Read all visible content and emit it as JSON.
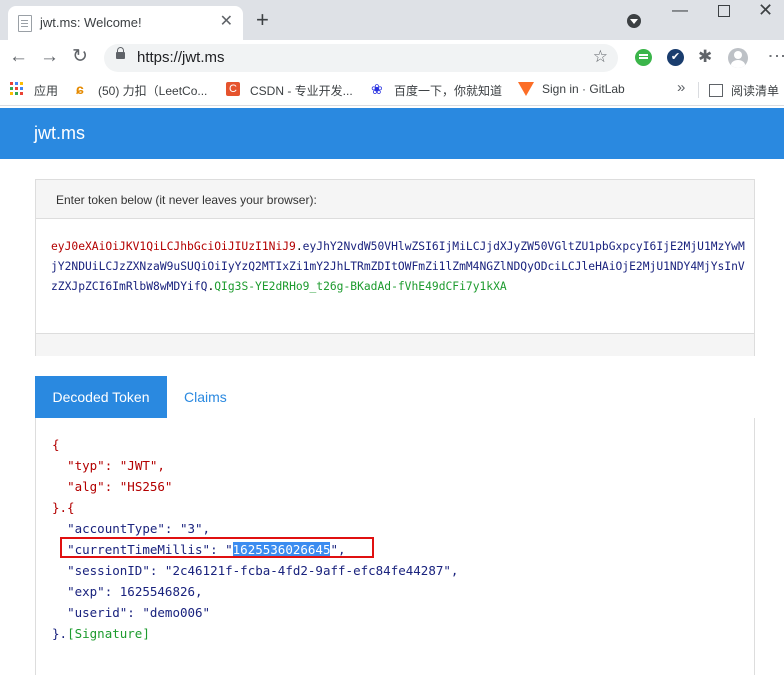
{
  "browser": {
    "tab_title": "jwt.ms: Welcome!",
    "tab_close": "✕",
    "new_tab": "+",
    "url": "https://jwt.ms",
    "win_min": "—",
    "win_close": "✕",
    "back": "←",
    "forward": "→",
    "reload": "↻",
    "star": "☆",
    "more": "⋮",
    "check": "✔",
    "puzzle": "✱",
    "bookmarks": [
      {
        "label": "应用"
      },
      {
        "label": "(50) 力扣（LeetCo..."
      },
      {
        "label": "CSDN - 专业开发..."
      },
      {
        "label": "百度一下，你就知道"
      },
      {
        "label": "Sign in · GitLab"
      }
    ],
    "bookmarks_more": "»",
    "reading_list": "阅读清单"
  },
  "page": {
    "brand": "jwt.ms",
    "input_prompt": "Enter token below (it never leaves your browser):",
    "token": {
      "header": "eyJ0eXAiOiJKV1QiLCJhbGciOiJIUzI1NiJ9",
      "dot1": ".",
      "payload": "eyJhY2NvdW50VHlwZSI6IjMiLCJjdXJyZW50VGltZU1pbGxpcyI6IjE2MjU1MzYwMjY2NDUiLCJzZXNzaW9uSUQiOiIyYzQ2MTIxZi1mY2JhLTRmZDItOWFmZi1lZmM4NGZlNDQyODciLCJleHAiOjE2MjU1NDY4MjYsInVzZXJpZCI6ImRlbW8wMDYifQ",
      "dot2": ".",
      "signature": "QIg3S-YE2dRHo9_t26g-BKadAd-fVhE49dCFi7y1kXA"
    },
    "tabs": {
      "decoded": "Decoded Token",
      "claims": "Claims"
    },
    "decoded": {
      "open_brace": "{",
      "typ_key": "\"typ\"",
      "typ_val": "\"JWT\"",
      "alg_key": "\"alg\"",
      "alg_val": "\"HS256\"",
      "close_dot": "}.{",
      "accountType_key": "\"accountType\"",
      "accountType_val": "\"3\"",
      "currentTimeMillis_key": "\"currentTimeMillis\"",
      "currentTimeMillis_val": "1625536026645",
      "sessionID_key": "\"sessionID\"",
      "sessionID_val": "\"2c46121f-fcba-4fd2-9aff-efc84fe44287\"",
      "exp_key": "\"exp\"",
      "exp_val": "1625546826",
      "userid_key": "\"userid\"",
      "userid_val": "\"demo006\"",
      "close_sig": "}.",
      "signature": "[Signature]"
    }
  },
  "colors": {
    "accent": "#2a89e0",
    "header_color": "#b30000",
    "payload_color": "#1a237e",
    "signature_color": "#1d9b2e",
    "highlight_border": "#e01010"
  }
}
